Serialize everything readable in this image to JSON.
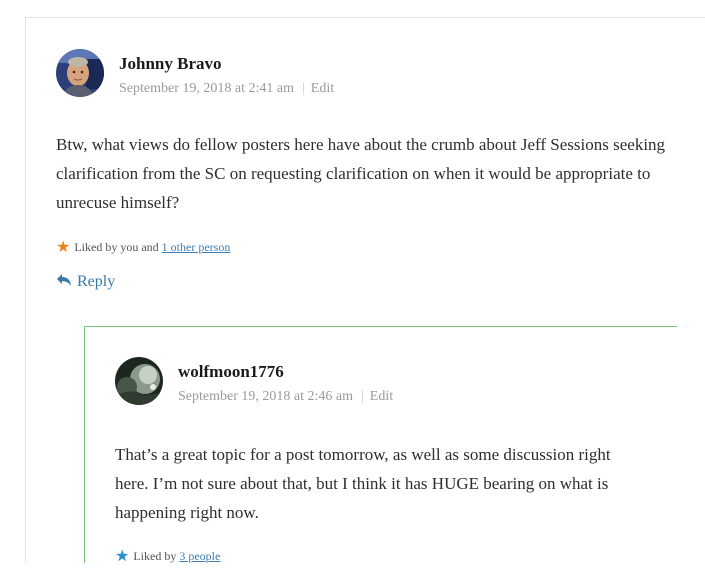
{
  "comment": {
    "author": "Johnny Bravo",
    "date": "September 19, 2018 at 2:41 am",
    "separator": "|",
    "edit_label": "Edit",
    "body": "Btw, what views do fellow posters here have about the crumb about Jeff Sessions seeking clarification from the SC on requesting clarification on when it would be appropriate to unrecuse himself?",
    "likes": {
      "prefix": "Liked by you and",
      "link": "1 other person",
      "star_color": "#f0821e"
    },
    "reply_label": "Reply"
  },
  "reply_comment": {
    "author": "wolfmoon1776",
    "date": "September 19, 2018 at 2:46 am",
    "separator": "|",
    "edit_label": "Edit",
    "body": "That’s a great topic for a post tomorrow, as well as some discussion right here. I’m not sure about that, but I think it has HUGE bearing on what is happening right now.",
    "likes": {
      "prefix": "Liked by",
      "link": "3 people",
      "star_color": "#2e8fcf"
    }
  },
  "colors": {
    "reply_link": "#3a78a8",
    "child_border": "#74c17a",
    "meta_text": "#9a9a9a"
  }
}
